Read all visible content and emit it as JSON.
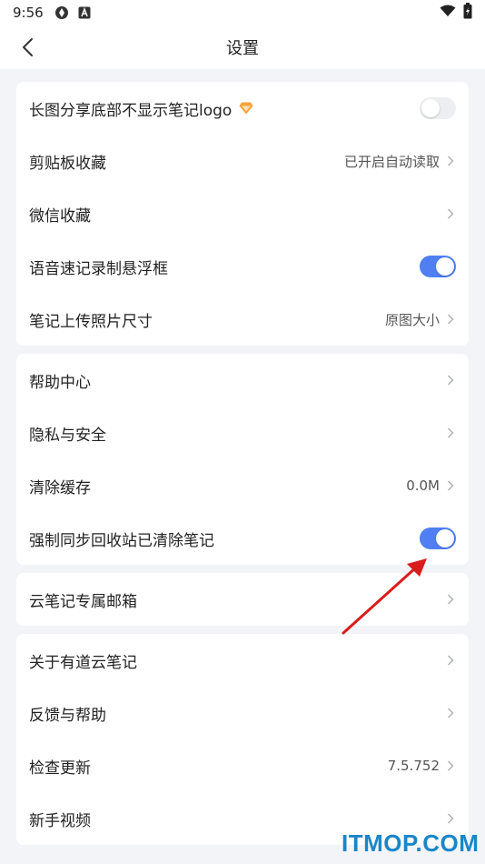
{
  "status_bar": {
    "time": "9:56"
  },
  "header": {
    "title": "设置"
  },
  "group1": {
    "long_image_label": "长图分享底部不显示笔记logo",
    "long_image_toggle": "off",
    "clipboard_label": "剪贴板收藏",
    "clipboard_value": "已开启自动读取",
    "wechat_label": "微信收藏",
    "voice_label": "语音速记录制悬浮框",
    "voice_toggle": "on",
    "photo_size_label": "笔记上传照片尺寸",
    "photo_size_value": "原图大小"
  },
  "group2": {
    "help_center_label": "帮助中心",
    "privacy_label": "隐私与安全",
    "cache_label": "清除缓存",
    "cache_value": "0.0M",
    "force_sync_label": "强制同步回收站已清除笔记",
    "force_sync_toggle": "on"
  },
  "group3": {
    "mailbox_label": "云笔记专属邮箱"
  },
  "group4": {
    "about_label": "关于有道云笔记",
    "feedback_label": "反馈与帮助",
    "update_label": "检查更新",
    "update_value": "7.5.752",
    "tutorial_label": "新手视频"
  },
  "watermark": "ITMOP.COM",
  "colors": {
    "accent": "#4f7ff3",
    "toggle_off": "#eceef2",
    "background": "#f3f4f7",
    "annotation_arrow": "#d91d1d",
    "watermark": "#1a86c8"
  }
}
